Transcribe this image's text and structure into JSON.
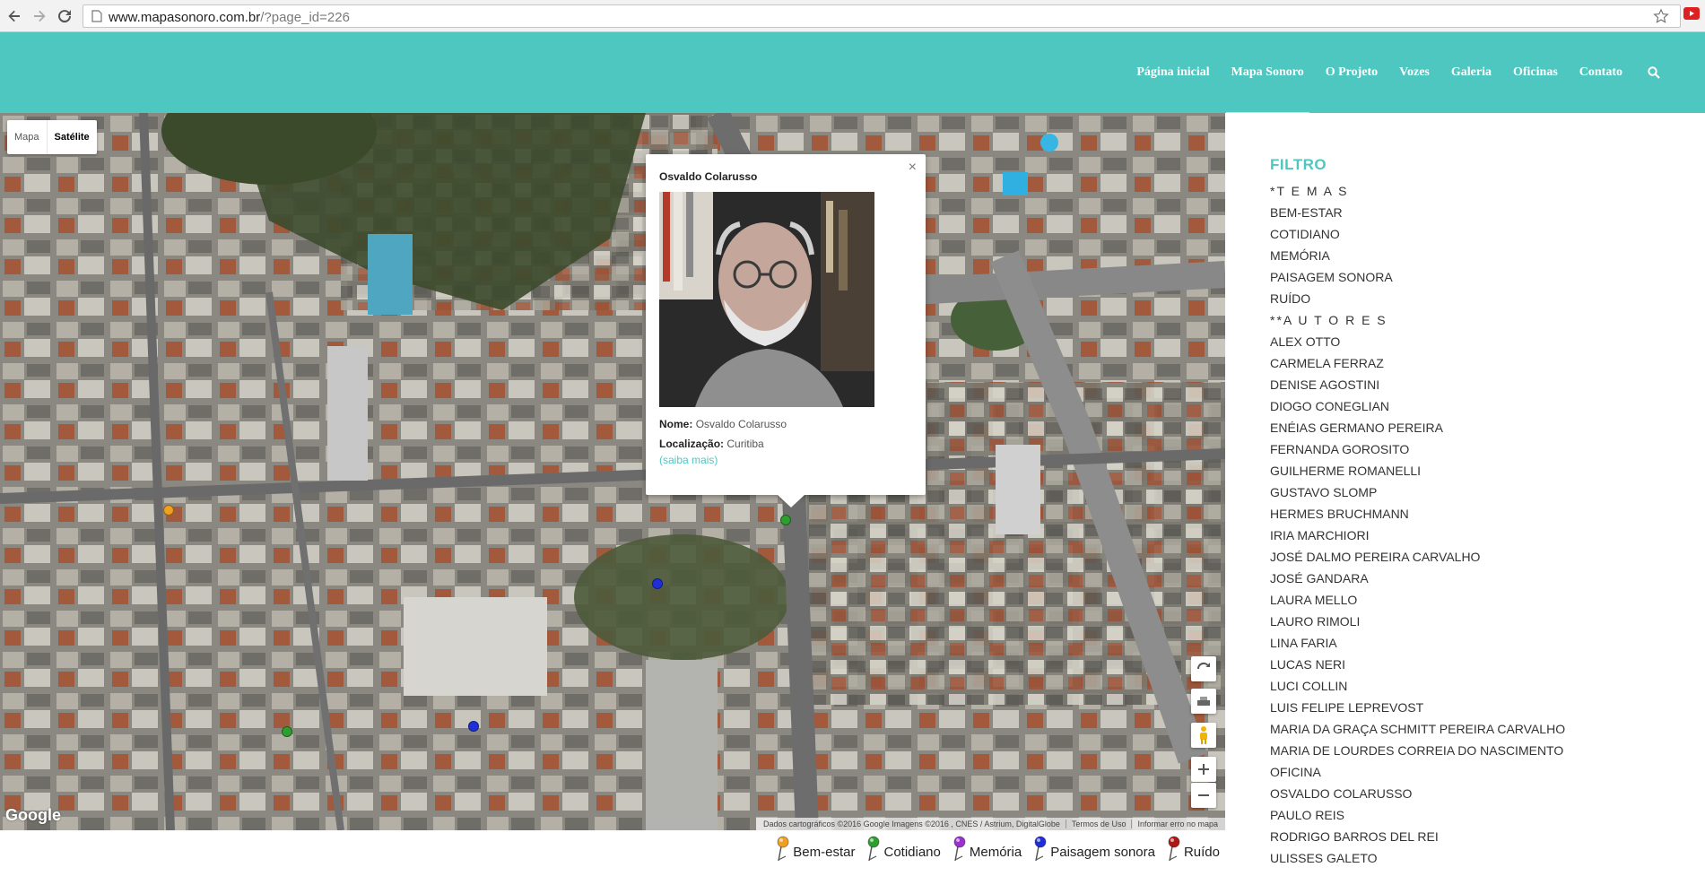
{
  "browser": {
    "url_host": "www.mapasonoro.com.br",
    "url_path": "/?page_id=226"
  },
  "header": {
    "accent_color": "#4ec7c0",
    "nav": [
      {
        "label": "Página inicial",
        "active": false
      },
      {
        "label": "Mapa Sonoro",
        "active": true
      },
      {
        "label": "O Projeto",
        "active": false
      },
      {
        "label": "Vozes",
        "active": false
      },
      {
        "label": "Galeria",
        "active": false
      },
      {
        "label": "Oficinas",
        "active": false
      },
      {
        "label": "Contato",
        "active": false
      }
    ],
    "search_icon": "search-icon"
  },
  "map": {
    "type_buttons": {
      "map": "Mapa",
      "satellite": "Satélite",
      "selected": "Satélite"
    },
    "info_window": {
      "title": "Osvaldo Colarusso",
      "close": "×",
      "name_label": "Nome:",
      "name_value": "Osvaldo Colarusso",
      "location_label": "Localização:",
      "location_value": "Curitiba",
      "more_link": "(saiba mais)"
    },
    "google_logo": "Google",
    "attribution": {
      "data": "Dados cartográficos ©2016 Google Imagens ©2016 , CNES / Astrium, DigitalGlobe",
      "terms": "Termos de Uso",
      "report": "Informar erro no mapa"
    },
    "controls": [
      "rotate-icon",
      "tilt-icon",
      "pegman-icon",
      "zoom-in-icon",
      "zoom-out-icon"
    ]
  },
  "legend": [
    {
      "label": "Bem-estar",
      "color": "#f0a020"
    },
    {
      "label": "Cotidiano",
      "color": "#2e9e2e"
    },
    {
      "label": "Memória",
      "color": "#9b2fd0"
    },
    {
      "label": "Paisagem sonora",
      "color": "#1f2ed8"
    },
    {
      "label": "Ruído",
      "color": "#b01818"
    }
  ],
  "sidebar": {
    "title": "FILTRO",
    "temas_header": "*T E M A S",
    "temas": [
      "BEM-ESTAR",
      "COTIDIANO",
      "MEMÓRIA",
      "PAISAGEM SONORA",
      "RUÍDO"
    ],
    "autores_header": "**A U T O R E S",
    "autores": [
      "ALEX OTTO",
      "CARMELA FERRAZ",
      "DENISE AGOSTINI",
      "DIOGO CONEGLIAN",
      "ENÉIAS GERMANO PEREIRA",
      "FERNANDA GOROSITO",
      "GUILHERME ROMANELLI",
      "GUSTAVO SLOMP",
      "HERMES BRUCHMANN",
      "IRIA MARCHIORI",
      "JOSÉ DALMO PEREIRA CARVALHO",
      "JOSÉ GANDARA",
      "LAURA MELLO",
      "LAURO RIMOLI",
      "LINA FARIA",
      "LUCAS NERI",
      "LUCI COLLIN",
      "LUIS FELIPE LEPREVOST",
      "MARIA DA GRAÇA SCHMITT PEREIRA CARVALHO",
      "MARIA DE LOURDES CORREIA DO NASCIMENTO",
      "OFICINA",
      "OSVALDO COLARUSSO",
      "PAULO REIS",
      "RODRIGO BARROS DEL REI",
      "ULISSES GALETO"
    ]
  }
}
